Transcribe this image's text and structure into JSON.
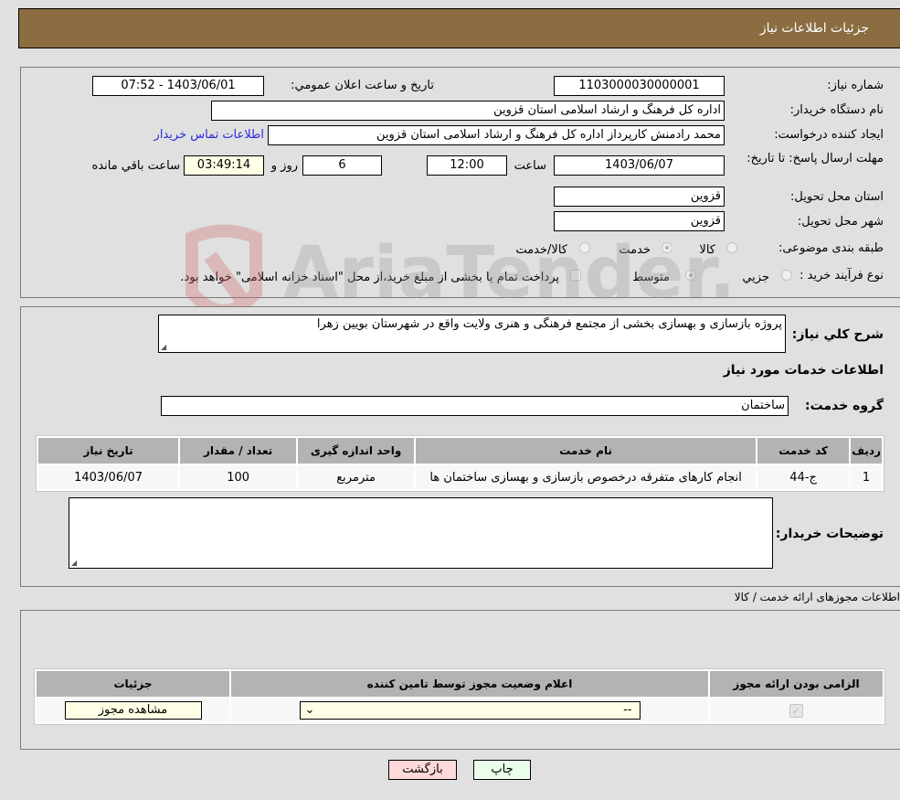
{
  "header": {
    "title": "جزئیات اطلاعات نیاز"
  },
  "info": {
    "need_number_label": "شماره نیاز:",
    "need_number": "1103000030000001",
    "announce_label": "تاریخ و ساعت اعلان عمومي:",
    "announce_value": "1403/06/01 - 07:52",
    "buyer_org_label": "نام دستگاه خریدار:",
    "buyer_org": "اداره کل فرهنگ و ارشاد اسلامی استان قزوین",
    "creator_label": "ایجاد کننده درخواست:",
    "creator": "محمد رادمنش کارپرداز اداره کل فرهنگ و ارشاد اسلامی استان قزوین",
    "contact_link": "اطلاعات تماس خریدار",
    "deadline_label": "مهلت ارسال پاسخ: تا تاریخ:",
    "deadline_date": "1403/06/07",
    "time_label": "ساعت",
    "deadline_time": "12:00",
    "days": "6",
    "days_label": "روز و",
    "remaining": "03:49:14",
    "remaining_label": "ساعت باقي مانده",
    "province_label": "استان محل تحویل:",
    "province": "قزوین",
    "city_label": "شهر محل تحویل:",
    "city": "قزوین",
    "category_label": "طبقه بندی موضوعی:",
    "category_options": [
      "کالا",
      "خدمت",
      "کالا/خدمت"
    ],
    "category_selected": "خدمت",
    "process_label": "نوع فرآیند خرید :",
    "process_options": [
      "جزيي",
      "متوسط"
    ],
    "process_selected": "متوسط",
    "treasury_note": "پرداخت تمام یا بخشی از مبلغ خرید،از محل \"اسناد خزانه اسلامی\" خواهد بود."
  },
  "summary": {
    "label": "شرح کلي نیاز:",
    "text": "پروژه بازسازی و بهسازی بخشی از مجتمع فرهنگی و هنری ولایت واقع در شهرستان بویین زهرا",
    "services_heading": "اطلاعات خدمات مورد نیاز",
    "group_label": "گروه خدمت:",
    "group_value": "ساختمان"
  },
  "services_table": {
    "headers": [
      "ردیف",
      "کد خدمت",
      "نام خدمت",
      "واحد اندازه گیری",
      "تعداد / مقدار",
      "تاریخ نیاز"
    ],
    "rows": [
      [
        "1",
        "ج-44",
        "انجام کارهای متفرقه درخصوص بازسازی و بهسازی ساختمان ها",
        "مترمربع",
        "100",
        "1403/06/07"
      ]
    ]
  },
  "buyer_notes": {
    "label": "توضیحات خریدار:",
    "value": ""
  },
  "permits": {
    "heading": "اطلاعات مجوزهای ارائه خدمت / کالا",
    "headers": [
      "الزامی بودن ارائه مجوز",
      "اعلام وضعیت مجوز توسط تامین کننده",
      "جزئیات"
    ],
    "select_value": "--",
    "view_button": "مشاهده مجوز",
    "required_checked": true
  },
  "buttons": {
    "print": "چاپ",
    "back": "بازگشت"
  },
  "watermark": {
    "text": "AriaTender.neT"
  }
}
